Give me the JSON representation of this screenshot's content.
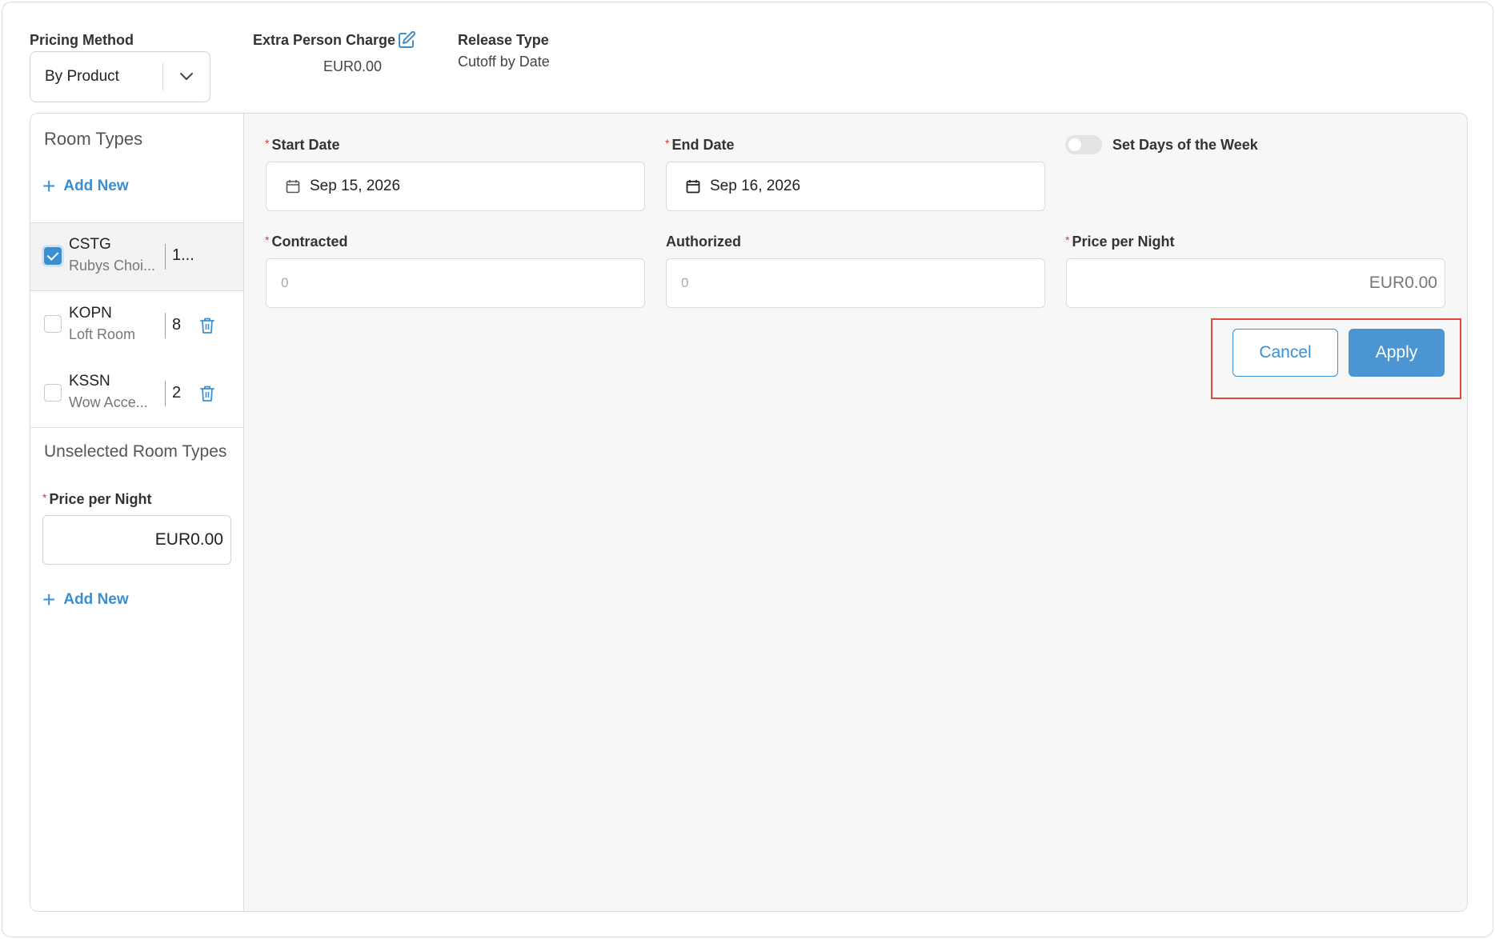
{
  "header": {
    "pricing_method_label": "Pricing Method",
    "pricing_method_value": "By Product",
    "extra_person_charge_label": "Extra Person Charge",
    "extra_person_charge_value": "EUR0.00",
    "release_type_label": "Release Type",
    "release_type_value": "Cutoff by Date"
  },
  "sidebar": {
    "room_types_title": "Room Types",
    "add_new_label": "Add New",
    "rooms": [
      {
        "code": "CSTG",
        "name": "Rubys Choi...",
        "count": "1...",
        "checked": true
      },
      {
        "code": "KOPN",
        "name": "Loft Room",
        "count": "8",
        "checked": false
      },
      {
        "code": "KSSN",
        "name": "Wow Acce...",
        "count": "2",
        "checked": false
      }
    ],
    "unselected_title": "Unselected Room Types",
    "unselected_price_label": "Price per Night",
    "unselected_price_value": "EUR0.00",
    "add_new_label_2": "Add New"
  },
  "form": {
    "start_date_label": "Start Date",
    "start_date_value": "Sep 15, 2026",
    "end_date_label": "End Date",
    "end_date_value": "Sep 16, 2026",
    "set_days_label": "Set Days of the Week",
    "set_days_enabled": false,
    "contracted_label": "Contracted",
    "contracted_placeholder": "0",
    "authorized_label": "Authorized",
    "authorized_placeholder": "0",
    "price_label": "Price per Night",
    "price_value": "EUR0.00",
    "cancel_label": "Cancel",
    "apply_label": "Apply"
  },
  "colors": {
    "accent": "#3b8fd0",
    "required": "#d9363e",
    "highlight": "#e0483d"
  }
}
